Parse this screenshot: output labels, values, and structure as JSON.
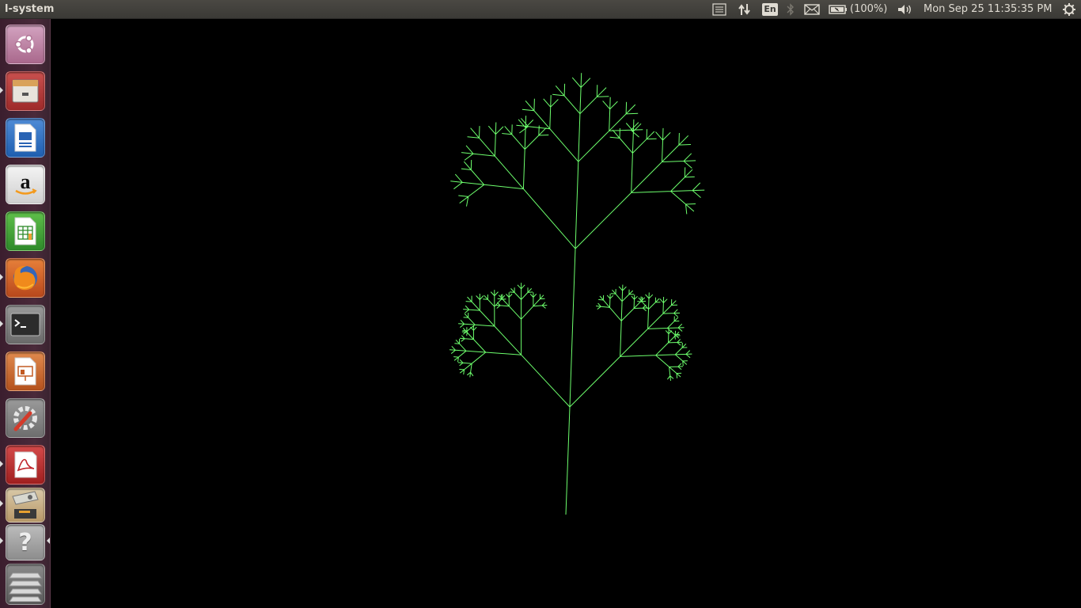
{
  "window": {
    "title": "l-system"
  },
  "panel": {
    "keyboard_layout": "En",
    "battery_text": "(100%)",
    "clock": "Mon Sep 25 11:35:35 PM",
    "icons": [
      "menu-list-icon",
      "network-updown-icon",
      "keyboard-layout-icon",
      "bluetooth-icon",
      "mail-icon",
      "battery-icon",
      "volume-icon",
      "session-gear-icon"
    ]
  },
  "launcher": {
    "items": [
      {
        "name": "ubuntu-dash",
        "icon": "ubuntu-logo-icon",
        "running": false
      },
      {
        "name": "files",
        "icon": "file-cabinet-icon",
        "running": true
      },
      {
        "name": "libreoffice-writer",
        "icon": "writer-document-icon",
        "running": false
      },
      {
        "name": "amazon",
        "icon": "amazon-icon",
        "running": false
      },
      {
        "name": "libreoffice-calc",
        "icon": "calc-spreadsheet-icon",
        "running": false
      },
      {
        "name": "firefox",
        "icon": "firefox-icon",
        "running": true
      },
      {
        "name": "terminal",
        "icon": "terminal-icon",
        "running": true
      },
      {
        "name": "libreoffice-impress",
        "icon": "impress-presentation-icon",
        "running": false
      },
      {
        "name": "system-settings",
        "icon": "settings-wrench-icon",
        "running": false
      },
      {
        "name": "pdf-viewer",
        "icon": "pdf-reader-icon",
        "running": true
      },
      {
        "name": "l-system-app",
        "icon": "app-window-icon",
        "running": true
      },
      {
        "name": "help",
        "icon": "help-question-icon",
        "running": true
      },
      {
        "name": "workspaces",
        "icon": "workspace-stack-icon",
        "running": false
      }
    ],
    "help_glyph": "?"
  },
  "canvas": {
    "background": "#000000",
    "stroke_color": "#6dff6d",
    "depth": 4
  }
}
